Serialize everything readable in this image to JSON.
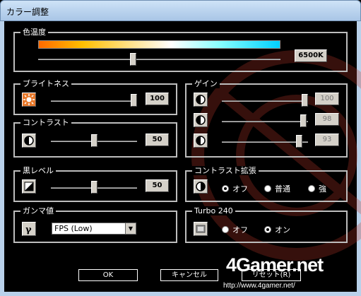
{
  "window": {
    "title": "カラー調整"
  },
  "color_temp": {
    "label": "色温度",
    "value": "6500K",
    "level": 0.39
  },
  "brightness": {
    "label": "ブライトネス",
    "value": "100",
    "level": 1.0
  },
  "contrast": {
    "label": "コントラスト",
    "value": "50",
    "level": 0.5
  },
  "black_level": {
    "label": "黒レベル",
    "value": "50",
    "level": 0.5
  },
  "gamma": {
    "label": "ガンマ値",
    "selected": "FPS (Low)"
  },
  "gain": {
    "label": "ゲイン",
    "channels": [
      {
        "value": "100",
        "level": 1.0
      },
      {
        "value": "98",
        "level": 0.98
      },
      {
        "value": "93",
        "level": 0.93
      }
    ]
  },
  "contrast_ext": {
    "label": "コントラスト拡張",
    "options": [
      "オフ",
      "普通",
      "強"
    ],
    "selected": "オフ"
  },
  "turbo": {
    "label": "Turbo 240",
    "options": [
      "オフ",
      "オン"
    ],
    "selected": "オン"
  },
  "buttons": {
    "ok": "OK",
    "cancel": "キャンセル",
    "reset": "リセット(R)"
  },
  "watermark": {
    "logo": "4Gamer.net",
    "url": "http://www.4gamer.net/"
  },
  "colors": {
    "accent_orange": "#ff6a00",
    "accent_cyan": "#00d0ff",
    "watermark_red": "#c0392b"
  }
}
